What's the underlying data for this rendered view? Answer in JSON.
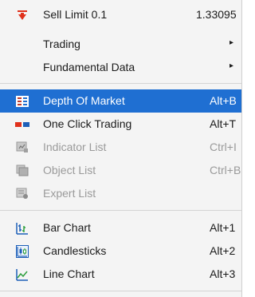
{
  "menu": {
    "items": [
      {
        "label": "Sell Limit 0.1",
        "value": "1.33095"
      },
      {
        "label": "Trading",
        "submenu": "▸"
      },
      {
        "label": "Fundamental Data",
        "submenu": "▸"
      },
      {
        "label": "Depth Of Market",
        "shortcut": "Alt+B",
        "selected": true
      },
      {
        "label": "One Click Trading",
        "shortcut": "Alt+T"
      },
      {
        "label": "Indicator List",
        "shortcut": "Ctrl+I",
        "disabled": true
      },
      {
        "label": "Object List",
        "shortcut": "Ctrl+B",
        "disabled": true
      },
      {
        "label": "Expert List",
        "disabled": true
      },
      {
        "label": "Bar Chart",
        "shortcut": "Alt+1"
      },
      {
        "label": "Candlesticks",
        "shortcut": "Alt+2"
      },
      {
        "label": "Line Chart",
        "shortcut": "Alt+3"
      }
    ]
  },
  "colors": {
    "selection": "#1f6fd2",
    "sell_icon": "#e0311c",
    "chart_icon": "#1d5fb8"
  },
  "icons": [
    "sell-arrow-icon",
    "depth-of-market-icon",
    "one-click-trading-icon",
    "indicator-list-icon",
    "object-list-icon",
    "expert-list-icon",
    "bar-chart-icon",
    "candlesticks-icon",
    "line-chart-icon"
  ]
}
